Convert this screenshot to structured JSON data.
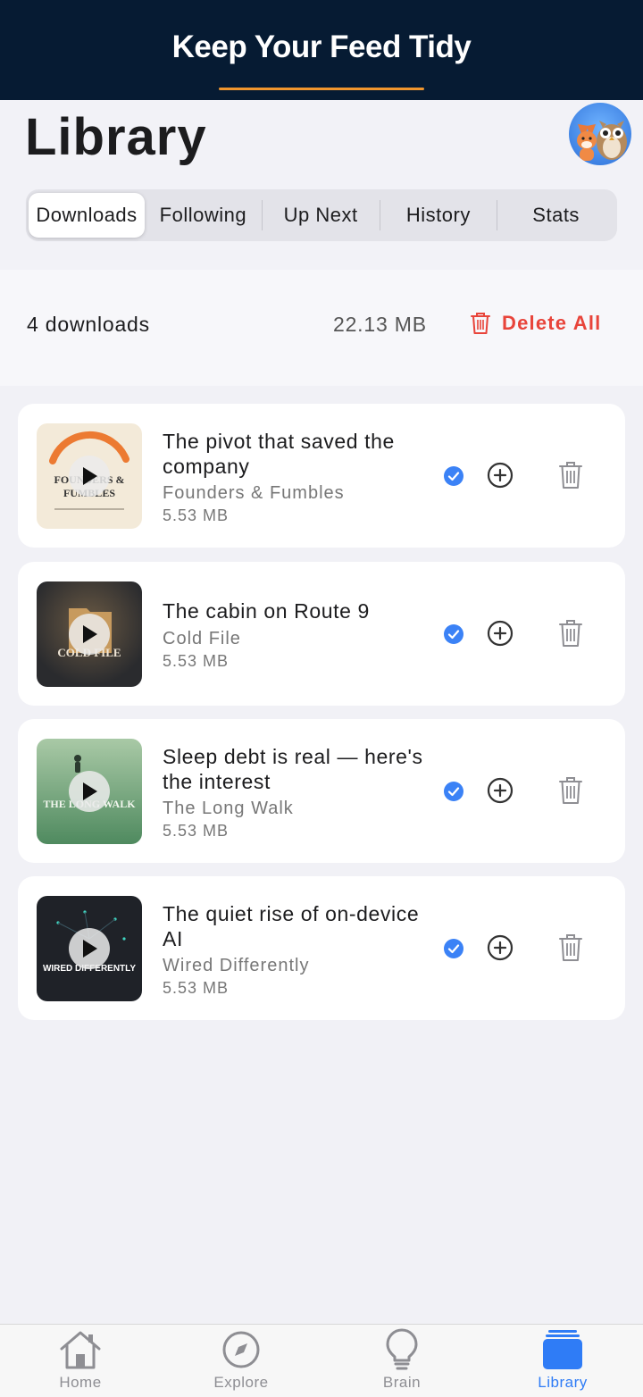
{
  "banner": {
    "title": "Keep Your Feed Tidy"
  },
  "page": {
    "title": "Library"
  },
  "tabs": [
    "Downloads",
    "Following",
    "Up Next",
    "History",
    "Stats"
  ],
  "active_tab": "Downloads",
  "summary": {
    "count_text": "4 downloads",
    "total_size": "22.13 MB",
    "delete_all_label": "Delete All"
  },
  "episodes": [
    {
      "title": "The pivot that saved the company",
      "show": "Founders & Fumbles",
      "size": "5.53 MB",
      "art_text": "FOUNDERS & FUMBLES",
      "downloaded": true
    },
    {
      "title": "The cabin on Route 9",
      "show": "Cold File",
      "size": "5.53 MB",
      "art_text": "COLD FILE",
      "downloaded": true
    },
    {
      "title": "Sleep debt is real — here's the interest",
      "show": "The Long Walk",
      "size": "5.53 MB",
      "art_text": "THE LONG WALK",
      "downloaded": true
    },
    {
      "title": "The quiet rise of on-device AI",
      "show": "Wired Differently",
      "size": "5.53 MB",
      "art_text": "WIRED DIFFERENTLY",
      "downloaded": true
    }
  ],
  "bottom_nav": [
    {
      "label": "Home",
      "icon": "home-icon"
    },
    {
      "label": "Explore",
      "icon": "compass-icon"
    },
    {
      "label": "Brain",
      "icon": "lightbulb-icon"
    },
    {
      "label": "Library",
      "icon": "library-icon",
      "active": true
    }
  ],
  "colors": {
    "banner_bg": "#061b33",
    "accent_orange": "#f0962e",
    "delete_red": "#e8443a",
    "active_blue": "#2f7cf6"
  }
}
